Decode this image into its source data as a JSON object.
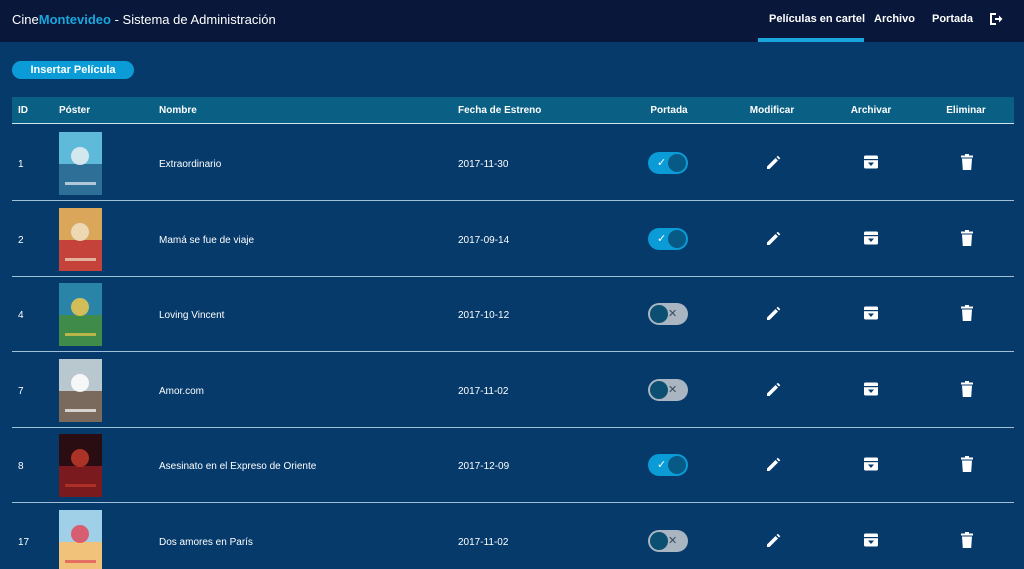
{
  "brand": {
    "part1": "Cine",
    "part2": "Montevideo",
    "part3": " - Sistema de Administración"
  },
  "nav": {
    "items": [
      {
        "label": "Películas en cartel",
        "active": true
      },
      {
        "label": "Archivo",
        "active": false
      },
      {
        "label": "Portada",
        "active": false
      }
    ],
    "logout_icon": "logout-icon"
  },
  "actions": {
    "insert_label": "Insertar Película"
  },
  "table": {
    "columns": [
      "ID",
      "Póster",
      "Nombre",
      "Fecha de Estreno",
      "Portada",
      "Modificar",
      "Archivar",
      "Eliminar"
    ],
    "rows": [
      {
        "id": "1",
        "name": "Extraordinario",
        "date": "2017-11-30",
        "portada": true,
        "poster_colors": [
          "#5fb9d9",
          "#2d6f96",
          "#e8eef2"
        ]
      },
      {
        "id": "2",
        "name": "Mamá se fue de viaje",
        "date": "2017-09-14",
        "portada": true,
        "poster_colors": [
          "#d9a65a",
          "#c4423a",
          "#f0e1c4"
        ]
      },
      {
        "id": "4",
        "name": "Loving Vincent",
        "date": "2017-10-12",
        "portada": false,
        "poster_colors": [
          "#2a84a8",
          "#3e8b4a",
          "#f0c84a"
        ]
      },
      {
        "id": "7",
        "name": "Amor.com",
        "date": "2017-11-02",
        "portada": false,
        "poster_colors": [
          "#b9c7cf",
          "#7a6a5d",
          "#ffffff"
        ]
      },
      {
        "id": "8",
        "name": "Asesinato en el Expreso de Oriente",
        "date": "2017-12-09",
        "portada": true,
        "poster_colors": [
          "#2a0d12",
          "#7a1a1f",
          "#c23a2a"
        ]
      },
      {
        "id": "17",
        "name": "Dos amores en París",
        "date": "2017-11-02",
        "portada": false,
        "poster_colors": [
          "#9fd0e8",
          "#f0c27a",
          "#e04a5a"
        ]
      }
    ]
  },
  "icons": {
    "edit": "pencil-icon",
    "archive": "archive-box-icon",
    "delete": "trash-icon"
  },
  "colors": {
    "navbar": "#08173a",
    "background": "#053a6b",
    "accent": "#19a6dd",
    "header": "#0a5f84"
  }
}
